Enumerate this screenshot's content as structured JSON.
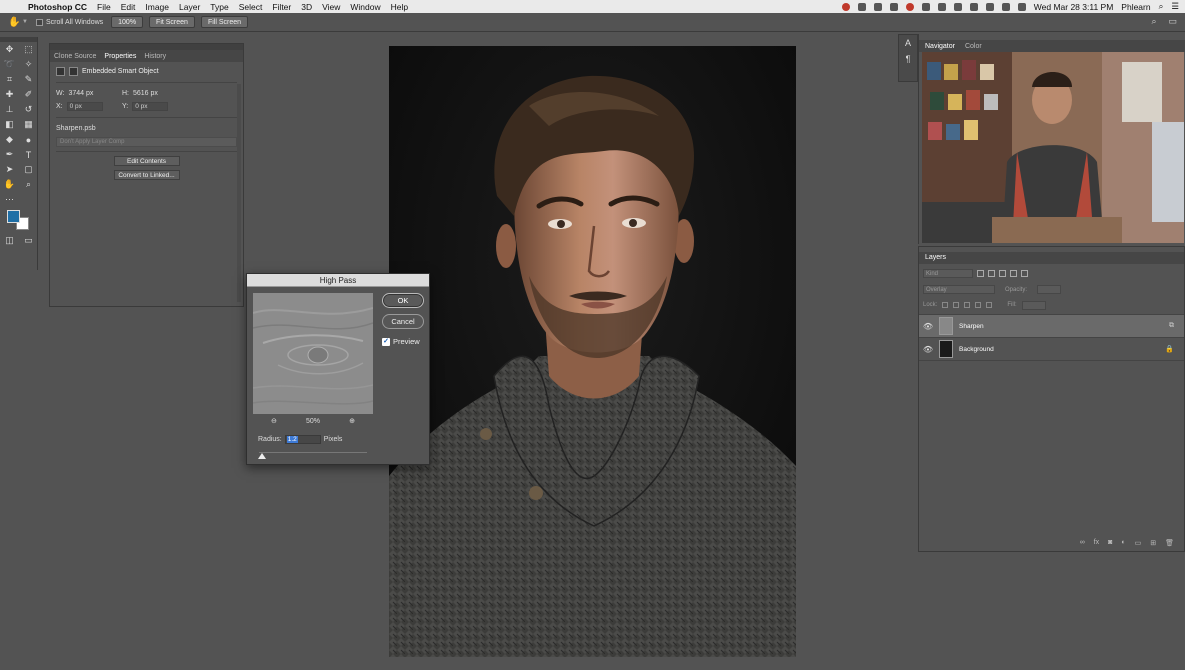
{
  "menubar": {
    "app_name": "Photoshop CC",
    "menus": [
      "File",
      "Edit",
      "Image",
      "Layer",
      "Type",
      "Select",
      "Filter",
      "3D",
      "View",
      "Window",
      "Help"
    ],
    "clock": "Wed Mar 28  3:11 PM",
    "user": "Phlearn"
  },
  "options_bar": {
    "scroll_all_windows": "Scroll All Windows",
    "zoom_100": "100%",
    "fit_screen": "Fit Screen",
    "fill_screen": "Fill Screen"
  },
  "properties_panel": {
    "tabs": [
      "Clone Source",
      "Properties",
      "History"
    ],
    "active_tab": "Properties",
    "header": "Embedded Smart Object",
    "w_label": "W:",
    "w_value": "3744 px",
    "h_label": "H:",
    "h_value": "5616 px",
    "x_label": "X:",
    "x_value": "0 px",
    "y_label": "Y:",
    "y_value": "0 px",
    "file_name": "Sharpen.psb",
    "layer_comp_placeholder": "Don't Apply Layer Comp",
    "edit_contents": "Edit Contents",
    "convert_to_linked": "Convert to Linked..."
  },
  "high_pass_dialog": {
    "title": "High Pass",
    "ok": "OK",
    "cancel": "Cancel",
    "preview_label": "Preview",
    "preview_checked": true,
    "zoom_level": "50%",
    "radius_label": "Radius:",
    "radius_value": "1.2",
    "unit": "Pixels"
  },
  "navigator_panel": {
    "tabs": [
      "Navigator",
      "Color"
    ],
    "active_tab": "Navigator"
  },
  "layers_panel": {
    "title": "Layers",
    "kind_placeholder": "Kind",
    "blend_mode": "Overlay",
    "opacity_label": "Opacity:",
    "lock_label": "Lock:",
    "fill_label": "Fill:",
    "layers": [
      {
        "name": "Sharpen",
        "selected": true
      },
      {
        "name": "Background",
        "selected": false
      }
    ]
  },
  "colors": {
    "foreground": "#1f6fa6",
    "background": "#ffffff",
    "ui_bg": "#535353"
  }
}
